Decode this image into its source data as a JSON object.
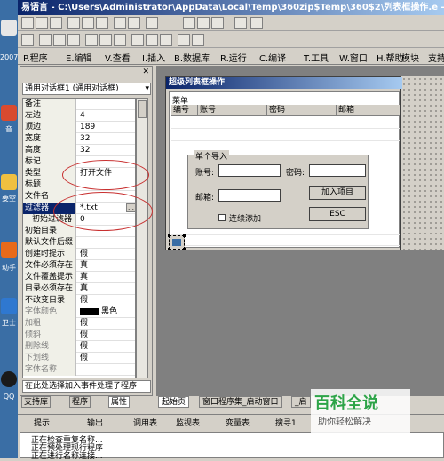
{
  "window": {
    "title": "易语言 - C:\\Users\\Administrator\\AppData\\Local\\Temp\\360zip$Temp\\360$2\\列表框操作.e - 窗口"
  },
  "desktop": {
    "labels": [
      "2007",
      "音",
      "要空",
      "动手",
      "卫士",
      "QQ"
    ]
  },
  "menu": {
    "items": [
      "P.程序",
      "E.编辑",
      "V.查看",
      "I.插入",
      "B.数据库",
      "R.运行",
      "C.编译",
      "T.工具",
      "W.窗口",
      "H.帮助",
      "模块",
      "支持"
    ]
  },
  "property_panel": {
    "header": "属性",
    "combo_value": "通用对话框1 (通用对话框)",
    "rows": [
      {
        "name": "备注",
        "value": ""
      },
      {
        "name": "左边",
        "value": "4"
      },
      {
        "name": "顶边",
        "value": "189"
      },
      {
        "name": "宽度",
        "value": "32"
      },
      {
        "name": "高度",
        "value": "32"
      },
      {
        "name": "标记",
        "value": ""
      },
      {
        "name": "类型",
        "value": "打开文件"
      },
      {
        "name": "标题",
        "value": ""
      },
      {
        "name": "文件名",
        "value": ""
      },
      {
        "name": "过滤器",
        "value": "*.txt"
      },
      {
        "name": "初始过滤器",
        "value": "0"
      },
      {
        "name": "初始目录",
        "value": ""
      },
      {
        "name": "默认文件后缀",
        "value": ""
      },
      {
        "name": "创建时提示",
        "value": "假"
      },
      {
        "name": "文件必须存在",
        "value": "真"
      },
      {
        "name": "文件覆盖提示",
        "value": "真"
      },
      {
        "name": "目录必须存在",
        "value": "真"
      },
      {
        "name": "不改变目录",
        "value": "假"
      },
      {
        "name": "字体颜色",
        "value": "黑色"
      },
      {
        "name": "加粗",
        "value": "假"
      },
      {
        "name": "倾斜",
        "value": "假"
      },
      {
        "name": "删除线",
        "value": "假"
      },
      {
        "name": "下划线",
        "value": "假"
      },
      {
        "name": "字体名称",
        "value": ""
      }
    ],
    "description": "在此处选择加入事件处理子程序",
    "tabs": [
      "支持库",
      "程序",
      "属性"
    ]
  },
  "form": {
    "title": "超级列表框操作",
    "listview_caption": "菜单",
    "columns": [
      "编号",
      "账号",
      "密码",
      "邮箱"
    ],
    "group_title": "单个导入",
    "account_label": "账号:",
    "password_label": "密码:",
    "email_label": "邮箱:",
    "add_button": "加入项目",
    "esc_button": "ESC",
    "checkbox_label": "连续添加"
  },
  "doc_tabs": [
    "起始页",
    "窗口程序集_启动窗口",
    "_启"
  ],
  "bottom_tabs": [
    "提示",
    "输出",
    "调用表",
    "监视表",
    "变量表",
    "搜寻1"
  ],
  "output_lines": [
    "正在检查重复名称...",
    "正在预处理现行程序",
    "正在进行名称连接..."
  ],
  "watermark": {
    "logo": "百科全说",
    "sub": "助你轻松解决"
  },
  "colors": {
    "title_start": "#0a246a",
    "title_end": "#a6caf0",
    "annotation": "#c83030",
    "watermark": "#2da448"
  }
}
